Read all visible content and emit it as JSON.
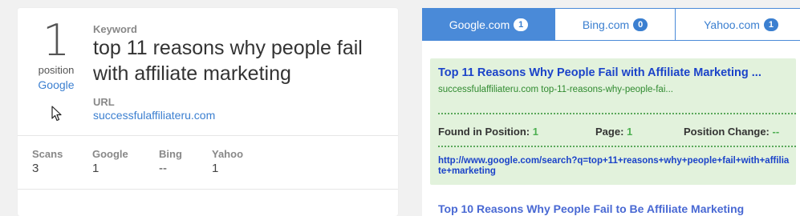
{
  "keyword_card": {
    "position_number": "1",
    "position_label": "position",
    "position_engine": "Google",
    "keyword_label": "Keyword",
    "keyword_text": "top 11 reasons why people fail with affiliate marketing",
    "url_label": "URL",
    "url_text": "successfulaffiliateru.com",
    "stats": [
      {
        "label": "Scans",
        "value": "3"
      },
      {
        "label": "Google",
        "value": "1"
      },
      {
        "label": "Bing",
        "value": "--"
      },
      {
        "label": "Yahoo",
        "value": "1"
      }
    ]
  },
  "tabs": [
    {
      "label": "Google.com",
      "count": "1",
      "active": true
    },
    {
      "label": "Bing.com",
      "count": "0",
      "active": false
    },
    {
      "label": "Yahoo.com",
      "count": "1",
      "active": false
    }
  ],
  "result": {
    "title": "Top 11 Reasons Why People Fail with Affiliate Marketing ...",
    "display_url": "successfulaffiliateru.com top-11-reasons-why-people-fai...",
    "found_label": "Found in Position:",
    "found_value": "1",
    "page_label": "Page:",
    "page_value": "1",
    "change_label": "Position Change:",
    "change_value": "--",
    "search_link": "http://www.google.com/search?q=top+11+reasons+why+people+fail+with+affiliate+marketing"
  },
  "next_result_title": "Top 10 Reasons Why People Fail to Be Affiliate Marketing"
}
